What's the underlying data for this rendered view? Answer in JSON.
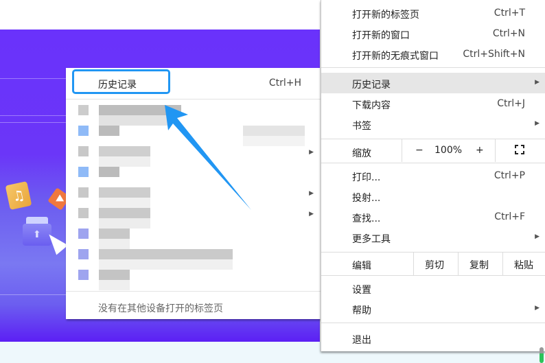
{
  "main_menu": {
    "items_top": [
      {
        "label": "打开新的标签页",
        "shortcut": "Ctrl+T"
      },
      {
        "label": "打开新的窗口",
        "shortcut": "Ctrl+N"
      },
      {
        "label": "打开新的无痕式窗口",
        "shortcut": "Ctrl+Shift+N"
      }
    ],
    "history": {
      "label": "历史记录"
    },
    "downloads": {
      "label": "下载内容",
      "shortcut": "Ctrl+J"
    },
    "bookmarks": {
      "label": "书签"
    },
    "zoom": {
      "label": "缩放",
      "minus": "−",
      "value": "100%",
      "plus": "+"
    },
    "print": {
      "label": "打印...",
      "shortcut": "Ctrl+P"
    },
    "cast": {
      "label": "投射..."
    },
    "find": {
      "label": "查找...",
      "shortcut": "Ctrl+F"
    },
    "more_tools": {
      "label": "更多工具"
    },
    "edit": {
      "label": "编辑",
      "cut": "剪切",
      "copy": "复制",
      "paste": "粘贴"
    },
    "settings": {
      "label": "设置"
    },
    "help": {
      "label": "帮助"
    },
    "exit": {
      "label": "退出"
    }
  },
  "history_submenu": {
    "header_label": "历史记录",
    "header_shortcut": "Ctrl+H",
    "footer": "没有在其他设备打开的标签页"
  },
  "accent_color": "#2196f3"
}
